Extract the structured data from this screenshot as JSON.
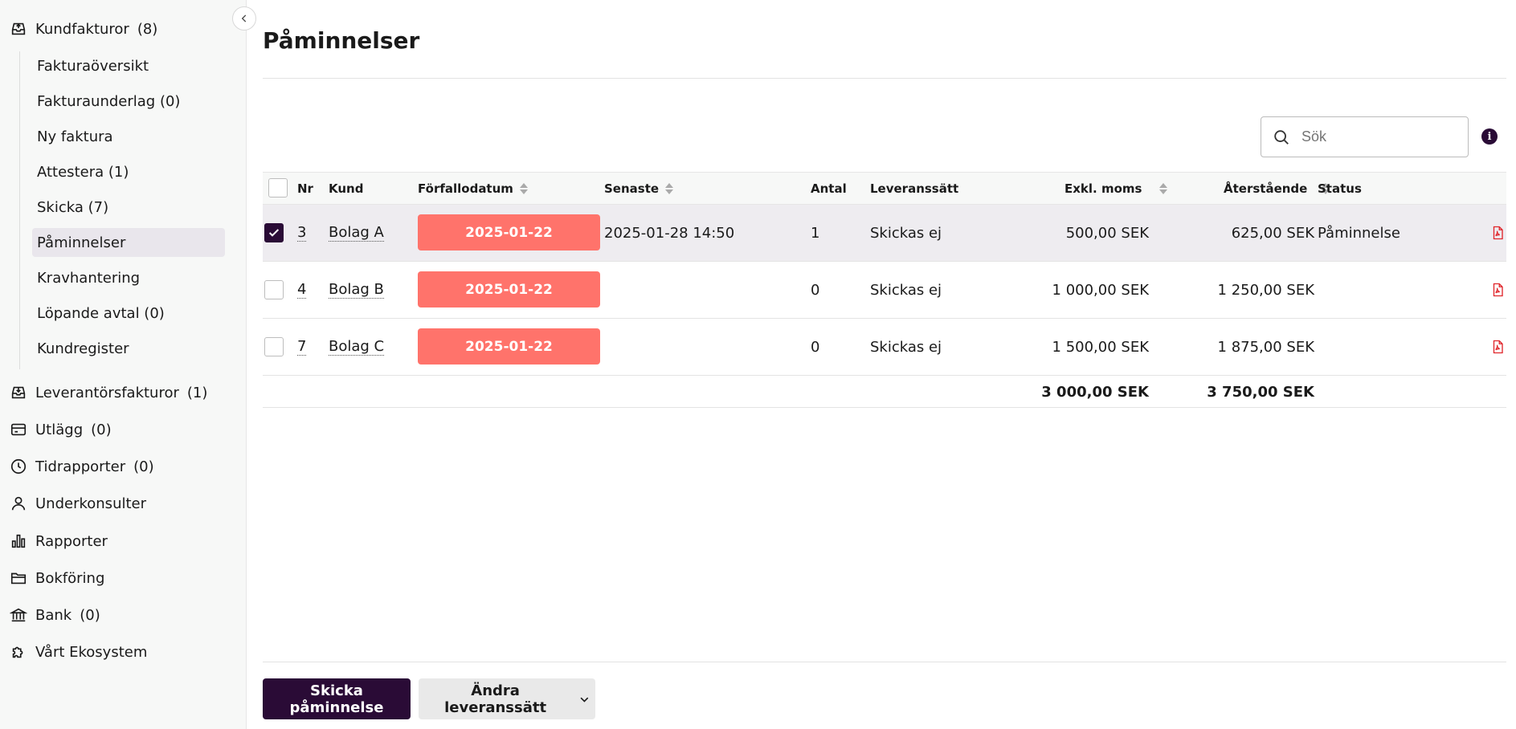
{
  "sidebar": {
    "kundfakturor": {
      "label": "Kundfakturor",
      "count": "(8)"
    },
    "sub_items": [
      {
        "label": "Fakturaöversikt"
      },
      {
        "label": "Fakturaunderlag (0)"
      },
      {
        "label": "Ny faktura"
      },
      {
        "label": "Attestera (1)"
      },
      {
        "label": "Skicka (7)"
      },
      {
        "label": "Påminnelser"
      },
      {
        "label": "Kravhantering"
      },
      {
        "label": "Löpande avtal (0)"
      },
      {
        "label": "Kundregister"
      }
    ],
    "groups": [
      {
        "label": "Leverantörsfakturor",
        "count": "(1)",
        "icon": "inbox-icon"
      },
      {
        "label": "Utlägg",
        "count": "(0)",
        "icon": "credit-card-icon"
      },
      {
        "label": "Tidrapporter",
        "count": "(0)",
        "icon": "clock-icon"
      },
      {
        "label": "Underkonsulter",
        "count": "",
        "icon": "user-icon"
      },
      {
        "label": "Rapporter",
        "count": "",
        "icon": "bar-chart-icon"
      },
      {
        "label": "Bokföring",
        "count": "",
        "icon": "folder-icon"
      },
      {
        "label": "Bank",
        "count": "(0)",
        "icon": "bank-icon"
      },
      {
        "label": "Vårt Ekosystem",
        "count": "",
        "icon": "puzzle-icon"
      }
    ]
  },
  "page": {
    "title": "Påminnelser"
  },
  "search": {
    "placeholder": "Sök",
    "value": ""
  },
  "table": {
    "headers": {
      "nr": "Nr",
      "kund": "Kund",
      "forfallodatum": "Förfallodatum",
      "senaste": "Senaste",
      "antal": "Antal",
      "leveranssatt": "Leveranssätt",
      "exkl_moms": "Exkl. moms",
      "aterstaende": "Återstående",
      "status": "Status"
    },
    "rows": [
      {
        "nr": "3",
        "kund": "Bolag A",
        "due": "2025-01-22",
        "senaste": "2025-01-28 14:50",
        "antal": "1",
        "leverans": "Skickas ej",
        "exkl": "500,00 SEK",
        "aterst": "625,00 SEK",
        "status": "Påminnelse",
        "checked": true
      },
      {
        "nr": "4",
        "kund": "Bolag B",
        "due": "2025-01-22",
        "senaste": "",
        "antal": "0",
        "leverans": "Skickas ej",
        "exkl": "1 000,00 SEK",
        "aterst": "1 250,00 SEK",
        "status": "",
        "checked": false
      },
      {
        "nr": "7",
        "kund": "Bolag C",
        "due": "2025-01-22",
        "senaste": "",
        "antal": "0",
        "leverans": "Skickas ej",
        "exkl": "1 500,00 SEK",
        "aterst": "1 875,00 SEK",
        "status": "",
        "checked": false
      }
    ],
    "totals": {
      "exkl": "3 000,00 SEK",
      "aterst": "3 750,00 SEK"
    }
  },
  "actions": {
    "send_label": "Skicka påminnelse",
    "change_label": "Ändra leveranssätt"
  },
  "colors": {
    "primary": "#2a0b36",
    "overdue": "#ff736b",
    "pdf": "#e0262b"
  }
}
